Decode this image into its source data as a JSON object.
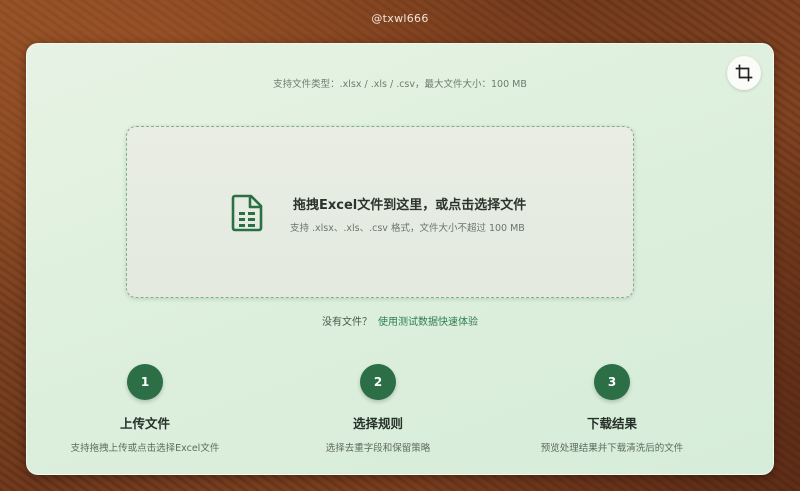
{
  "watermark": "@txwl666",
  "header": {
    "support_types": "支持文件类型：.xlsx / .xls / .csv，最大文件大小：100 MB"
  },
  "toolbar": {
    "crop_icon": "crop-icon"
  },
  "dropzone": {
    "icon": "file-spreadsheet-icon",
    "title": "拖拽Excel文件到这里，或点击选择文件",
    "subtitle": "支持 .xlsx、.xls、.csv 格式，文件大小不超过 100 MB"
  },
  "no_file": {
    "prompt": "没有文件？",
    "link": "使用测试数据快速体验"
  },
  "steps": [
    {
      "number": "1",
      "title": "上传文件",
      "desc": "支持拖拽上传或点击选择Excel文件"
    },
    {
      "number": "2",
      "title": "选择规则",
      "desc": "选择去重字段和保留策略"
    },
    {
      "number": "3",
      "title": "下载结果",
      "desc": "预览处理结果并下载清洗后的文件"
    }
  ],
  "colors": {
    "accent": "#2c6e45",
    "link": "#2e7d4f",
    "card_bg": "#dcefdc"
  }
}
